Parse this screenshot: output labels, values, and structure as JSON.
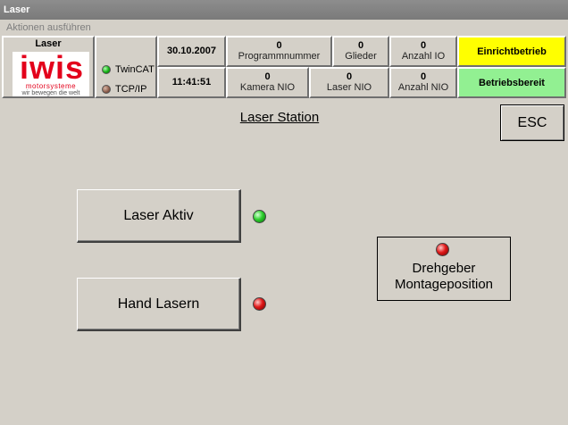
{
  "window": {
    "title": "Laser"
  },
  "menu": {
    "actions_label": "Aktionen ausführen"
  },
  "header": {
    "logo": {
      "title": "Laser",
      "brand": "iwis",
      "brand_sub": "motorsysteme",
      "slogan": "wir bewegen die welt"
    },
    "status": {
      "twincat_label": "TwinCAT",
      "twincat_color": "#1db81d",
      "tcpip_label": "TCP/IP",
      "tcpip_color": "#8a5a48"
    },
    "date": "30.10.2007",
    "time": "11:41:51",
    "counters": [
      {
        "value": "0",
        "label": "Programmnummer"
      },
      {
        "value": "0",
        "label": "Glieder"
      },
      {
        "value": "0",
        "label": "Anzahl IO"
      },
      {
        "value": "0",
        "label": "Kamera NIO"
      },
      {
        "value": "0",
        "label": "Laser NIO"
      },
      {
        "value": "0",
        "label": "Anzahl NIO"
      }
    ],
    "mode": {
      "label": "Einrichtbetrieb",
      "color": "#ffff00"
    },
    "ready": {
      "label": "Betriebsbereit",
      "color": "#92f092"
    }
  },
  "main": {
    "title": "Laser Station",
    "esc_label": "ESC",
    "laser_active": {
      "label": "Laser Aktiv",
      "led_color": "#2ed02e"
    },
    "hand_laser": {
      "label": "Hand Lasern",
      "led_color": "#e01818"
    },
    "encoder": {
      "line1": "Drehgeber",
      "line2": "Montageposition",
      "led_color": "#e01818"
    }
  }
}
